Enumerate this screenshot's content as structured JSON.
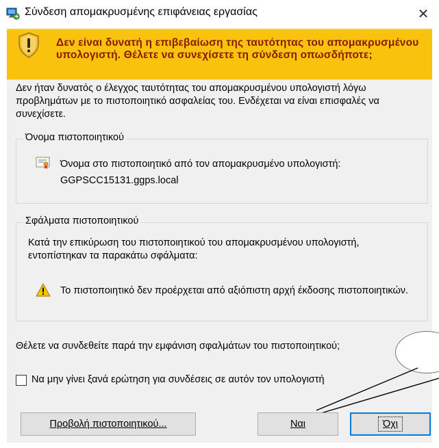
{
  "window": {
    "title": "Σύνδεση απομακρυσμένης επιφάνειας εργασίας",
    "close_glyph": "✕"
  },
  "banner": {
    "message": "Δεν είναι δυνατή η επιβεβαίωση της ταυτότητας του απομακρυσμένου υπολογιστή. Θέλετε να συνεχίσετε τη σύνδεση οπωσδήποτε;",
    "background_color": "#f9c20c",
    "text_color": "#8b1a00",
    "icon": "shield-warning-icon"
  },
  "description": "Δεν ήταν δυνατός ο έλεγχος ταυτότητας του απομακρυσμένου υπολογιστή λόγω προβλημάτων με το πιστοποιητικό ασφαλείας του. Ενδέχεται να είναι επισφαλές να συνεχίσετε.",
  "certificate_name_group": {
    "label": "Όνομα πιστοποιητικού",
    "line1": "Όνομα στο πιστοποιητικό από τον απομακρυσμένο υπολογιστή:",
    "line2": "GGPSCC15131.ggps.local",
    "icon": "certificate-icon"
  },
  "certificate_errors_group": {
    "label": "Σφάλματα πιστοποιητικού",
    "intro": "Κατά την επικύρωση του πιστοποιητικού του απομακρυσμένου υπολογιστή, εντοπίστηκαν τα παρακάτω σφάλματα:",
    "error": "Το πιστοποιητικό δεν προέρχεται από αξιόπιστη αρχή έκδοσης πιστοποιητικών.",
    "icon": "warning-triangle-icon"
  },
  "question": "Θέλετε να συνδεθείτε παρά την εμφάνιση σφαλμάτων του πιστοποιητικού;",
  "checkbox": {
    "label": "Να μην γίνει ξανά ερώτηση για συνδέσεις σε αυτόν τον υπολογιστή",
    "checked": false
  },
  "buttons": {
    "view_certificate": "Προβολή πιστοποιητικού...",
    "yes": "Ναι",
    "no": "Όχι"
  },
  "accent_color": "#0078d7"
}
